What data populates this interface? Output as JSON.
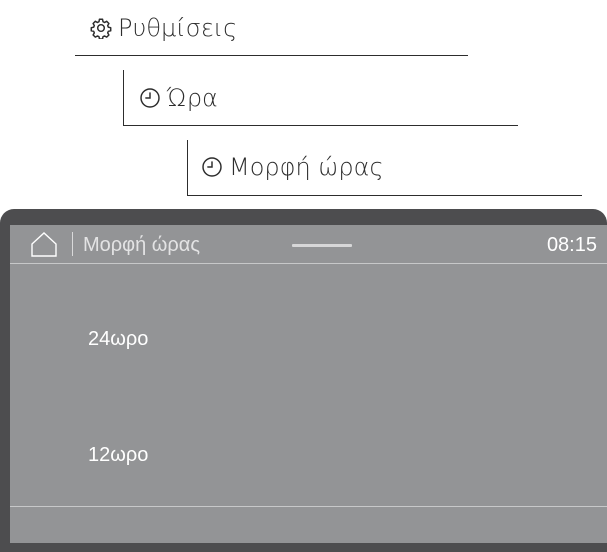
{
  "breadcrumb": {
    "level1": {
      "label": "Ρυθμίσεις",
      "icon": "gear-icon"
    },
    "level2": {
      "label": "Ώρα",
      "icon": "clock-icon"
    },
    "level3": {
      "label": "Μορφή ώρας",
      "icon": "clock-icon"
    }
  },
  "screen": {
    "title": "Μορφή ώρας",
    "time": "08:15",
    "home_icon": "home-icon",
    "options": [
      {
        "label": "24ωρο"
      },
      {
        "label": "12ωρο"
      }
    ]
  },
  "colors": {
    "device_frame": "#4d4d4f",
    "screen_bg": "#939496",
    "text_light": "#ffffff",
    "path_text": "#2d2d2d"
  }
}
